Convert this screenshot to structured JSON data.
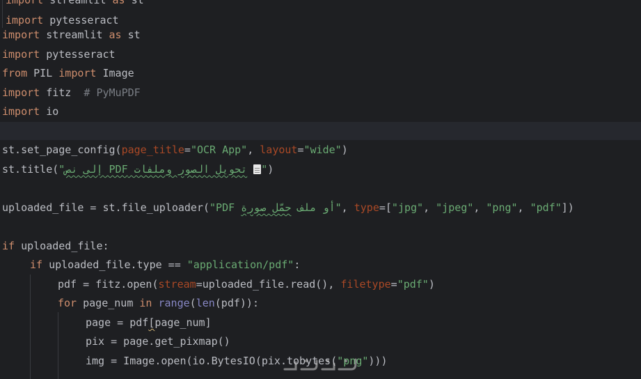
{
  "editor": {
    "overlay_lines": [
      {
        "kw": "import",
        "rest": " streamlit ",
        "kw2": "as",
        "rest2": " st"
      },
      {
        "kw": "import",
        "rest": " pytesseract"
      }
    ],
    "lines": {
      "l1_kw": "import",
      "l1_mod": " streamlit ",
      "l1_as": "as",
      "l1_alias": " st",
      "l2_kw": "import",
      "l2_mod": " pytesseract",
      "l3_from": "from",
      "l3_mod": " PIL ",
      "l3_import": "import",
      "l3_name": " Image",
      "l4_kw": "import",
      "l4_mod": " fitz  ",
      "l4_comment": "# PyMuPDF",
      "l5_kw": "import",
      "l5_mod": " io",
      "l7_a": "st.set_page_config(",
      "l7_k1": "page_title",
      "l7_eq1": "=",
      "l7_s1": "\"OCR App\"",
      "l7_c1": ", ",
      "l7_k2": "layout",
      "l7_eq2": "=",
      "l7_s2": "\"wide\"",
      "l7_end": ")",
      "l8_a": "st.title(",
      "l8_q1": "\"",
      "l8_ar": "تحويل الصور وملفات PDF إلى نص",
      "l8_q2": "\"",
      "l8_end": ")",
      "l10_a": "uploaded_file = st.file_uploader(",
      "l10_s1": "\"PDF أو ملف",
      "l10_s1b": "حمّل صورة",
      "l10_s1c": "\"",
      "l10_c": ", ",
      "l10_k": "type",
      "l10_eq": "=[",
      "l10_v1": "\"jpg\"",
      "l10_sep1": ", ",
      "l10_v2": "\"jpeg\"",
      "l10_sep2": ", ",
      "l10_v3": "\"png\"",
      "l10_sep3": ", ",
      "l10_v4": "\"pdf\"",
      "l10_end": "])",
      "l12_if": "if",
      "l12_rest": " uploaded_file:",
      "l13_if": "if",
      "l13_rest": " uploaded_file.type == ",
      "l13_s": "\"application/pdf\"",
      "l13_end": ":",
      "l14_a": "pdf = fitz.open(",
      "l14_k1": "stream",
      "l14_m": "=uploaded_file.read(), ",
      "l14_k2": "filetype",
      "l14_eq": "=",
      "l14_s": "\"pdf\"",
      "l14_end": ")",
      "l15_for": "for",
      "l15_var": " page_num ",
      "l15_in": "in",
      "l15_sp": " ",
      "l15_range": "range",
      "l15_p": "(",
      "l15_len": "len",
      "l15_end": "(pdf)):",
      "l16_a": "page = pdf",
      "l16_b": "[",
      "l16_c": "page_num]",
      "l17_a": "pix = page.get_pixmap()",
      "l18_a": "img = Image.open(io.BytesIO(pix.tobytes(",
      "l18_s": "\"png\"",
      "l18_end": ")))"
    }
  },
  "watermark": {
    "text": "كماشات"
  }
}
